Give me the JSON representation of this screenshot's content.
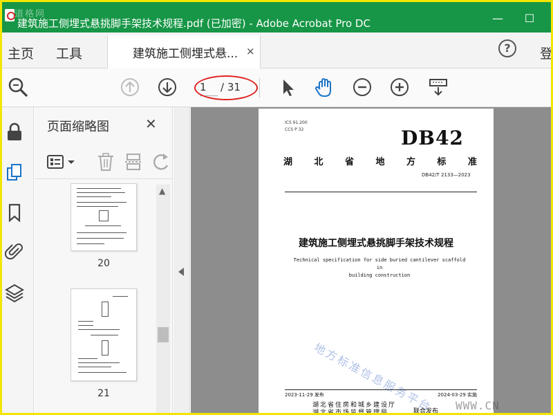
{
  "window": {
    "title": "建筑施工侧埋式悬挑脚手架技术规程.pdf  (已加密)  - Adobe Acrobat Pro DC",
    "watermark": "道格网",
    "minimize_glyph": "—",
    "maximize_glyph": "☐"
  },
  "menu": {
    "home": "主页",
    "tools": "工具",
    "doc_tab": "建筑施工侧埋式悬...",
    "close_tab": "×",
    "help": "?",
    "login": "登"
  },
  "toolbar": {
    "current_page": "1",
    "total_pages": "/ 31"
  },
  "thumbnails": {
    "title": "页面缩略图",
    "close": "✕",
    "pages": [
      {
        "number": "20"
      },
      {
        "number": "21"
      }
    ]
  },
  "document": {
    "ics_line": "ICS  91.200",
    "ccs_line": "CCS  P 32",
    "standard_type": "DB42",
    "province_chars": [
      "湖",
      "北",
      "省",
      "地",
      "方",
      "标",
      "准"
    ],
    "code": "DB42/T 2133—2023",
    "title_cn": "建筑施工侧埋式悬挑脚手架技术规程",
    "title_en_1": "Technical specification for side buried cantilever scaffold in",
    "title_en_2": "building construction",
    "watermark": "地方标准信息服务平台",
    "publish_date": "2023-11-29 发布",
    "effective_date": "2024-03-29 实施",
    "issuer_1": "湖北省住房和城乡建设厅",
    "issuer_2": "湖北省市场监督管理局",
    "joint": "联合发布"
  },
  "footer_watermark": "WWW.CN",
  "colors": {
    "titlebar": "#169646",
    "annotation": "#e0201f",
    "frame": "#f2e600"
  }
}
